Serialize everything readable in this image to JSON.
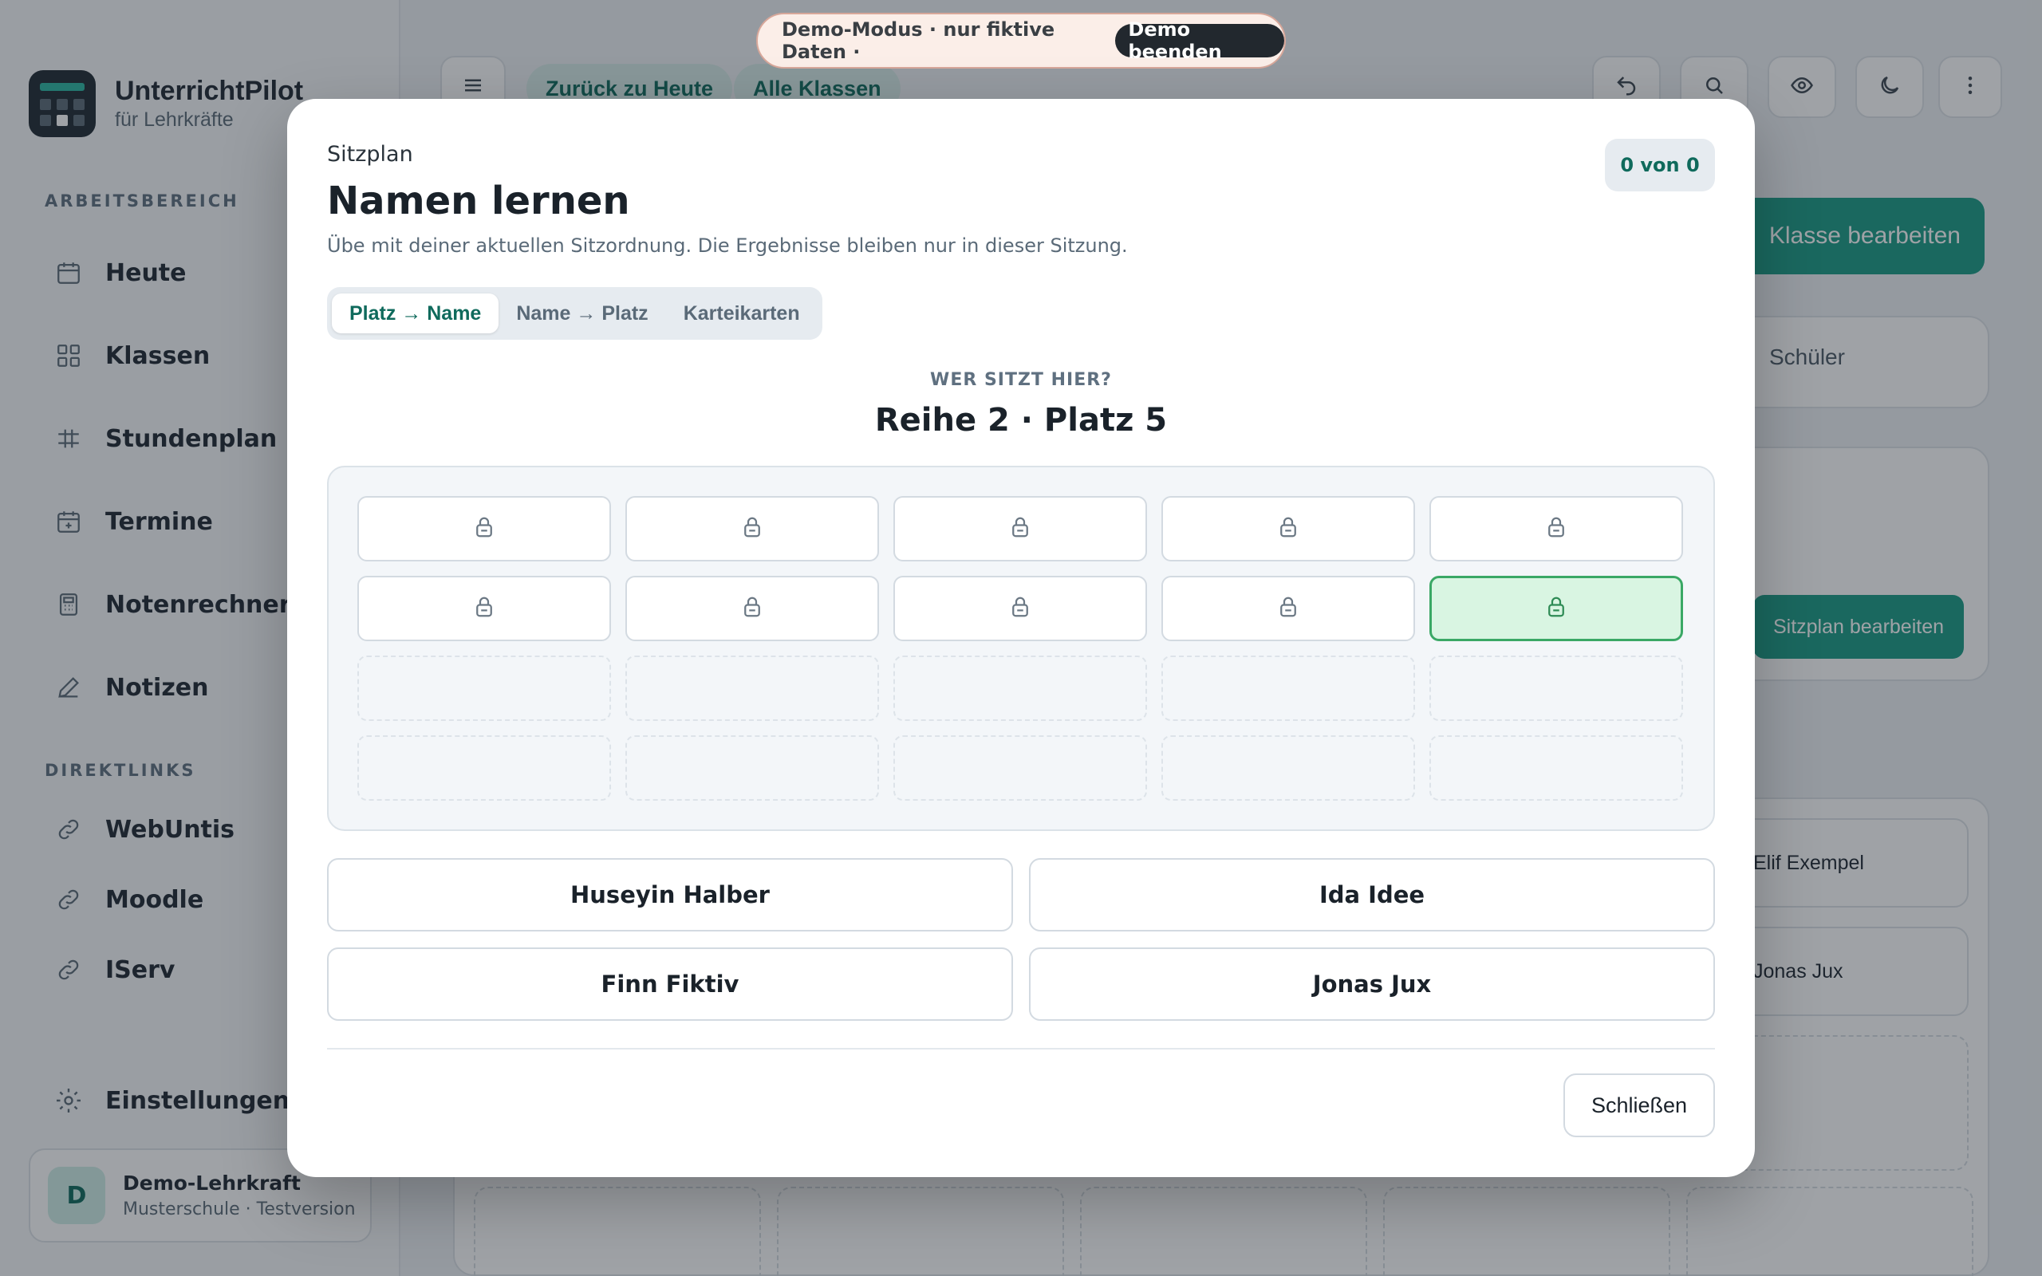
{
  "brand": {
    "title": "UnterrichtPilot",
    "subtitle": "für Lehrkräfte"
  },
  "sidebar": {
    "workspace_label": "ARBEITSBEREICH",
    "workspace_items": [
      {
        "label": "Heute",
        "icon": "calendar-icon"
      },
      {
        "label": "Klassen",
        "icon": "grid-icon"
      },
      {
        "label": "Stundenplan",
        "icon": "table-icon"
      },
      {
        "label": "Termine",
        "icon": "calendar-plus-icon"
      },
      {
        "label": "Notenrechner",
        "icon": "calculator-icon"
      },
      {
        "label": "Notizen",
        "icon": "pencil-icon"
      }
    ],
    "links_label": "DIREKTLINKS",
    "link_items": [
      {
        "label": "WebUntis",
        "icon": "link-icon"
      },
      {
        "label": "Moodle",
        "icon": "link-icon"
      },
      {
        "label": "IServ",
        "icon": "link-icon"
      }
    ],
    "settings_label": "Einstellungen",
    "profile": {
      "initial": "D",
      "name": "Demo-Lehrkraft",
      "subtitle": "Musterschule · Testversion"
    }
  },
  "topbar": {
    "back_pill": "Zurück zu Heute",
    "classes_pill": "Alle Klassen",
    "demo_text": "Demo-Modus · nur fiktive Daten ·",
    "demo_end": "Demo beenden"
  },
  "background": {
    "edit_class": "Klasse bearbeiten",
    "students_tab": "Schüler",
    "edit_seating": "Sitzplan bearbeiten",
    "students": [
      "Elif Exempel",
      "Jonas Jux"
    ]
  },
  "modal": {
    "eyebrow": "Sitzplan",
    "title": "Namen lernen",
    "subtitle": "Übe mit deiner aktuellen Sitzordnung. Die Ergebnisse bleiben nur in dieser Sitzung.",
    "counter": "0 von 0",
    "modes": [
      "Platz → Name",
      "Name → Platz",
      "Karteikarten"
    ],
    "active_mode": 0,
    "question_label": "WER SITZT HIER?",
    "question_seat": "Reihe 2 · Platz 5",
    "seats": [
      [
        "filled",
        "filled",
        "filled",
        "filled",
        "filled"
      ],
      [
        "filled",
        "filled",
        "filled",
        "filled",
        "highlight"
      ],
      [
        "empty",
        "empty",
        "empty",
        "empty",
        "empty"
      ],
      [
        "empty",
        "empty",
        "empty",
        "empty",
        "empty"
      ]
    ],
    "answers": [
      "Huseyin Halber",
      "Ida Idee",
      "Finn Fiktiv",
      "Jonas Jux"
    ],
    "close": "Schließen"
  },
  "colors": {
    "accent": "#1a9c86",
    "highlight_bg": "#d9f5e2",
    "highlight_border": "#3aa865"
  }
}
